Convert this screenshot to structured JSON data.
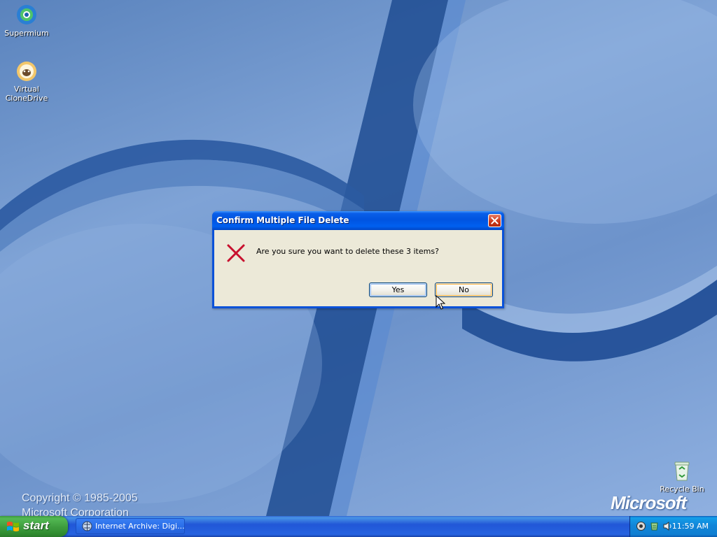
{
  "desktop": {
    "icons": [
      {
        "label": "Supermium",
        "icon": "supermium-browser-icon"
      },
      {
        "label": "Virtual CloneDrive",
        "icon": "virtual-clonedrive-sheep-icon"
      },
      {
        "label": "Recycle Bin",
        "icon": "recycle-bin-icon"
      }
    ],
    "watermark": {
      "copyright_line1": "Copyright © 1985-2005",
      "copyright_line2": "Microsoft Corporation",
      "logo": "Microsoft"
    }
  },
  "dialog": {
    "title": "Confirm Multiple File Delete",
    "icon": "error-x-icon",
    "message": "Are you sure you want to delete these 3 items?",
    "buttons": {
      "yes": "Yes",
      "no": "No"
    },
    "close_icon": "close-icon"
  },
  "taskbar": {
    "start_label": "start",
    "tasks": [
      {
        "label": "Internet Archive: Digi...",
        "icon": "browser-icon"
      }
    ],
    "tray": {
      "icons": [
        "network-icon",
        "recycle-tray-icon",
        "volume-icon"
      ],
      "clock": "11:59 AM"
    }
  },
  "colors": {
    "titlebar_blue": "#0053e0",
    "dialog_face": "#ece9d8",
    "start_green": "#3f9e3f",
    "taskbar_blue": "#2157d7",
    "tray_blue": "#1185d8"
  }
}
